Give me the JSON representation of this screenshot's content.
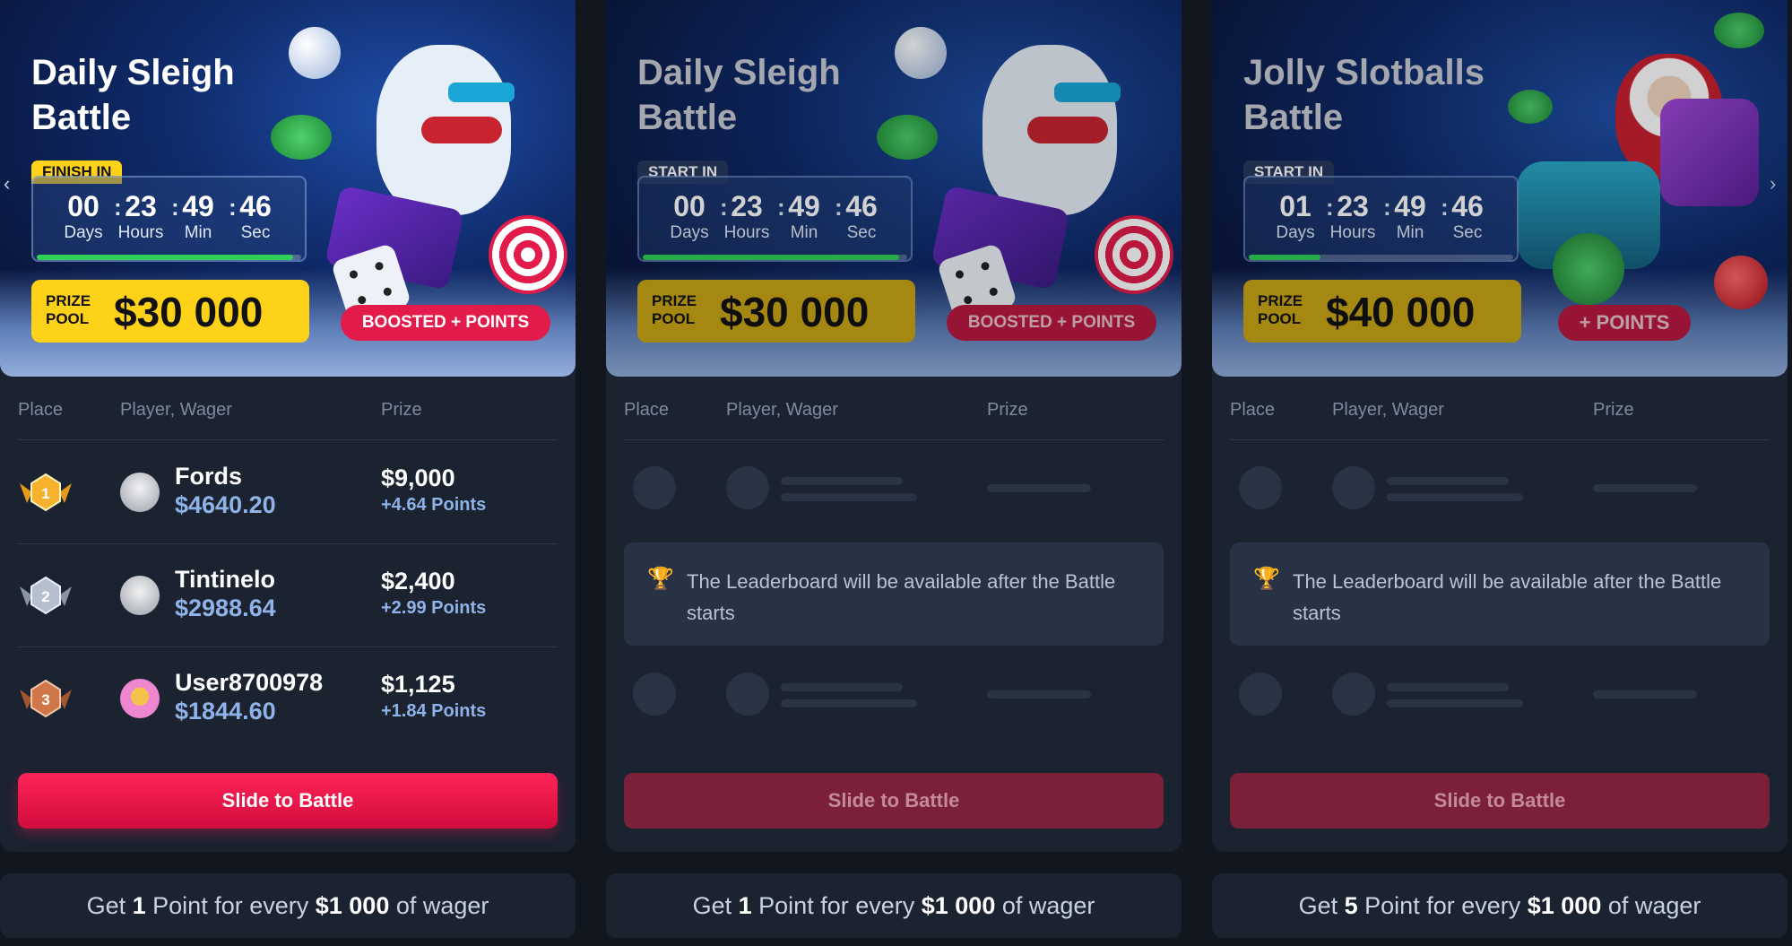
{
  "cards": [
    {
      "title": "Daily Sleigh Battle",
      "timer_label": "FINISH IN",
      "timer": {
        "days": "00",
        "hours": "23",
        "min": "49",
        "sec": "46",
        "progress": 0.97
      },
      "prize_pool_label_1": "PRIZE",
      "prize_pool_label_2": "POOL",
      "prize_amount": "$30 000",
      "badge": "BOOSTED + POINTS",
      "columns": {
        "place": "Place",
        "player": "Player, Wager",
        "prize": "Prize"
      },
      "leaderboard": [
        {
          "place": "1",
          "name": "Fords",
          "wager": "$4640.20",
          "prize": "$9,000",
          "points": "+4.64 Points"
        },
        {
          "place": "2",
          "name": "Tintinelo",
          "wager": "$2988.64",
          "prize": "$2,400",
          "points": "+2.99 Points"
        },
        {
          "place": "3",
          "name": "User8700978",
          "wager": "$1844.60",
          "prize": "$1,125",
          "points": "+1.84 Points"
        }
      ],
      "button": "Slide to Battle",
      "footer": {
        "pre": "Get",
        "count": "1",
        "mid": "Point for every",
        "amount": "$1 000",
        "post": "of wager"
      }
    },
    {
      "title": "Daily Sleigh Battle",
      "timer_label": "START IN",
      "timer": {
        "days": "00",
        "hours": "23",
        "min": "49",
        "sec": "46",
        "progress": 0.97
      },
      "prize_pool_label_1": "PRIZE",
      "prize_pool_label_2": "POOL",
      "prize_amount": "$30 000",
      "badge": "BOOSTED + POINTS",
      "columns": {
        "place": "Place",
        "player": "Player, Wager",
        "prize": "Prize"
      },
      "notice": "The Leaderboard will be available after the Battle starts",
      "button": "Slide to Battle",
      "footer": {
        "pre": "Get",
        "count": "1",
        "mid": "Point for every",
        "amount": "$1 000",
        "post": "of wager"
      }
    },
    {
      "title": "Jolly Slotballs Battle",
      "timer_label": "START IN",
      "timer": {
        "days": "01",
        "hours": "23",
        "min": "49",
        "sec": "46",
        "progress": 0.27
      },
      "prize_pool_label_1": "PRIZE",
      "prize_pool_label_2": "POOL",
      "prize_amount": "$40 000",
      "badge": "+ POINTS",
      "columns": {
        "place": "Place",
        "player": "Player, Wager",
        "prize": "Prize"
      },
      "notice": "The Leaderboard will be available after the Battle starts",
      "button": "Slide to Battle",
      "footer": {
        "pre": "Get",
        "count": "5",
        "mid": "Point for every",
        "amount": "$1 000",
        "post": "of wager"
      }
    }
  ],
  "timer_units": {
    "days": "Days",
    "hours": "Hours",
    "min": "Min",
    "sec": "Sec"
  },
  "nav": {
    "prev": "‹",
    "next": "›"
  },
  "icons": {
    "trophy": "🏆"
  },
  "colors": {
    "accent_red": "#e21b4a",
    "prize_yellow": "#ffd21a",
    "wager_blue": "#8fb3e8",
    "progress_green": "#2fcf58"
  }
}
